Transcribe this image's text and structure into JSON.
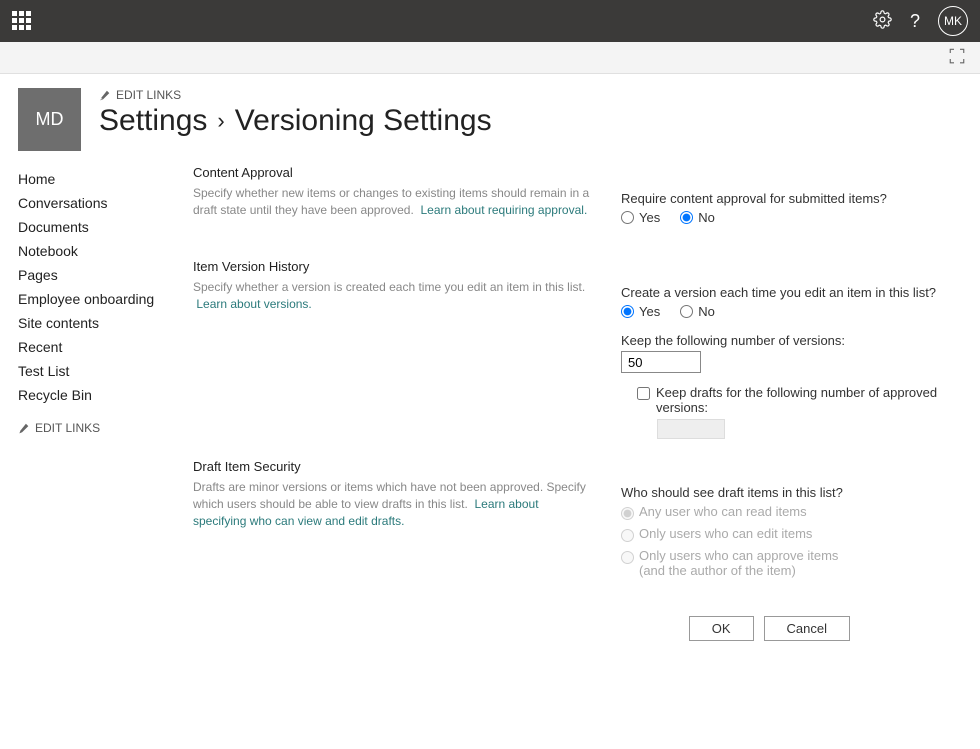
{
  "topbar": {
    "avatar_initials": "MK"
  },
  "site": {
    "logo_initials": "MD",
    "edit_links_label": "EDIT LINKS",
    "breadcrumb_root": "Settings",
    "breadcrumb_current": "Versioning Settings"
  },
  "sidebar": {
    "items": [
      "Home",
      "Conversations",
      "Documents",
      "Notebook",
      "Pages",
      "Employee onboarding",
      "Site contents",
      "Recent",
      "Test List",
      "Recycle Bin"
    ],
    "edit_links_label": "EDIT LINKS"
  },
  "sections": {
    "approval": {
      "title": "Content Approval",
      "desc": "Specify whether new items or changes to existing items should remain in a draft state until they have been approved.",
      "link": "Learn about requiring approval.",
      "question": "Require content approval for submitted items?",
      "yes": "Yes",
      "no": "No"
    },
    "history": {
      "title": "Item Version History",
      "desc": "Specify whether a version is created each time you edit an item in this list.",
      "link": "Learn about versions.",
      "q1": "Create a version each time you edit an item in this list?",
      "yes": "Yes",
      "no": "No",
      "keep_versions_label": "Keep the following number of versions:",
      "keep_versions_value": "50",
      "keep_drafts_label": "Keep drafts for the following number of approved versions:"
    },
    "draft": {
      "title": "Draft Item Security",
      "desc": "Drafts are minor versions or items which have not been approved. Specify which users should be able to view drafts in this list.",
      "link": "Learn about specifying who can view and edit drafts.",
      "question": "Who should see draft items in this list?",
      "opt1": "Any user who can read items",
      "opt2": "Only users who can edit items",
      "opt3": "Only users who can approve items (and the author of the item)"
    }
  },
  "buttons": {
    "ok": "OK",
    "cancel": "Cancel"
  }
}
